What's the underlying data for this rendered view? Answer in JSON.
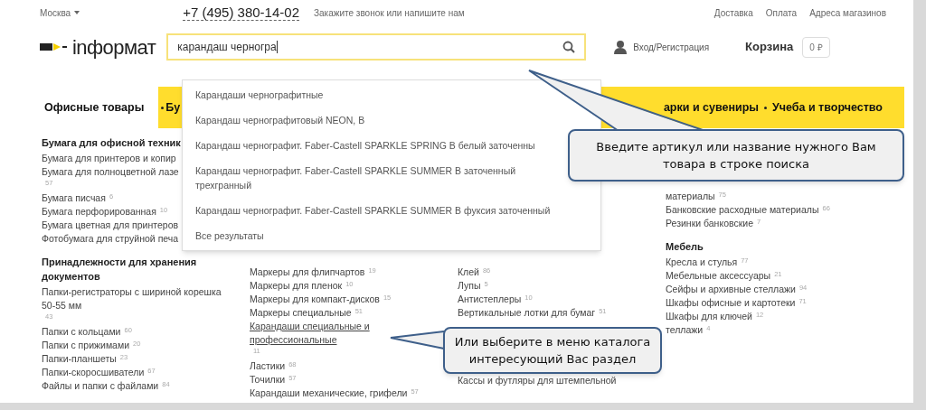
{
  "topbar": {
    "city": "Москва",
    "phone": "+7 (495) 380-14-02",
    "callback": "Закажите звонок или напишите нам",
    "links": [
      "Доставка",
      "Оплата",
      "Адреса магазинов"
    ]
  },
  "header": {
    "logo": "inформат",
    "search_value": "карандаш черногра",
    "login": "Вход/Регистрация",
    "cart": "Корзина",
    "cart_total": "0 ₽"
  },
  "suggestions": {
    "items": [
      "Карандаши чернографитные",
      "Карандаш чернографитовый NEON, B",
      "Карандаш чернографит. Faber-Castell SPARKLE SPRING B белый заточенны",
      "Карандаш чернографит. Faber-Castell SPARKLE SUMMER B заточенный трехгранный",
      "Карандаш чернографит. Faber-Castell SPARKLE SUMMER B фуксия заточенный"
    ],
    "all_results": "Все результаты"
  },
  "nav": [
    {
      "label": "Офисные товары",
      "selected": true
    },
    {
      "label": "Бу",
      "selected": false
    },
    {
      "label": "арки и сувениры",
      "selected": false
    },
    {
      "label": "Учеба и творчество",
      "selected": false
    }
  ],
  "columns": [
    [
      {
        "kind": "heading",
        "label": "Бумага для офисной техник"
      },
      {
        "kind": "link",
        "label": "Бумага для принтеров и копир",
        "hovered": false
      },
      {
        "kind": "link",
        "label": "Бумага для полноцветной лазе",
        "count": "57",
        "hovered": false
      },
      {
        "kind": "link",
        "label": "Бумага писчая",
        "count": "6",
        "hovered": false
      },
      {
        "kind": "link",
        "label": "Бумага перфорированная",
        "count": "10",
        "hovered": false
      },
      {
        "kind": "link",
        "label": "Бумага цветная для принтеров",
        "hovered": false
      },
      {
        "kind": "link",
        "label": "Фотобумага для струйной печа",
        "hovered": false
      },
      {
        "kind": "heading",
        "label": "Принадлежности для хранения документов"
      },
      {
        "kind": "link",
        "label": "Папки-регистраторы с шириной корешка 50-55 мм",
        "count": "43",
        "hovered": false
      },
      {
        "kind": "link",
        "label": "Папки с кольцами",
        "count": "60",
        "hovered": false
      },
      {
        "kind": "link",
        "label": "Папки с прижимами",
        "count": "20",
        "hovered": false
      },
      {
        "kind": "link",
        "label": "Папки-планшеты",
        "count": "23",
        "hovered": false
      },
      {
        "kind": "link",
        "label": "Папки-скоросшиватели",
        "count": "67",
        "hovered": false
      },
      {
        "kind": "link",
        "label": "Файлы и папки с файлами",
        "count": "84",
        "hovered": false
      }
    ],
    [
      {
        "kind": "link",
        "label": "Маркеры для флипчартов",
        "count": "19",
        "hovered": false
      },
      {
        "kind": "link",
        "label": "Маркеры для пленок",
        "count": "10",
        "hovered": false
      },
      {
        "kind": "link",
        "label": "Маркеры для компакт-дисков",
        "count": "15",
        "hovered": false
      },
      {
        "kind": "link",
        "label": "Маркеры специальные",
        "count": "51",
        "hovered": false
      },
      {
        "kind": "link",
        "label": "Карандаши специальные и профессиональные",
        "count": "11",
        "hovered": true
      },
      {
        "kind": "link",
        "label": "Ластики",
        "count": "68",
        "hovered": false
      },
      {
        "kind": "link",
        "label": "Точилки",
        "count": "57",
        "hovered": false
      },
      {
        "kind": "link",
        "label": "Карандаши механические, грифели",
        "count": "57",
        "hovered": false
      }
    ],
    [
      {
        "kind": "link",
        "label": "Клей",
        "count": "86",
        "hovered": false
      },
      {
        "kind": "link",
        "label": "Лупы",
        "count": "5",
        "hovered": false
      },
      {
        "kind": "link",
        "label": "Антистеплеры",
        "count": "10",
        "hovered": false
      },
      {
        "kind": "link",
        "label": "Вертикальные лотки для бумаг",
        "count": "51",
        "hovered": false
      },
      {
        "kind": "spacer"
      },
      {
        "kind": "link",
        "label": "Кассы и футляры для штемпельной",
        "hovered": false
      }
    ],
    [
      {
        "kind": "link",
        "label": "материалы",
        "count": "75",
        "hovered": false
      },
      {
        "kind": "link",
        "label": "Банковские расходные материалы",
        "count": "66",
        "hovered": false
      },
      {
        "kind": "link",
        "label": "Резинки банковские",
        "count": "7",
        "hovered": false
      },
      {
        "kind": "heading",
        "label": "Мебель"
      },
      {
        "kind": "link",
        "label": "Кресла и стулья",
        "count": "77",
        "hovered": false
      },
      {
        "kind": "link",
        "label": "Мебельные аксессуары",
        "count": "21",
        "hovered": false
      },
      {
        "kind": "link",
        "label": "Сейфы и архивные стеллажи",
        "count": "94",
        "hovered": false
      },
      {
        "kind": "link",
        "label": "Шкафы офисные и картотеки",
        "count": "71",
        "hovered": false
      },
      {
        "kind": "link",
        "label": "Шкафы для ключей",
        "count": "12",
        "hovered": false
      },
      {
        "kind": "link",
        "label": "теллажи",
        "count": "4",
        "hovered": false
      }
    ]
  ],
  "callouts": [
    "Введите артикул или название нужного Вам товара в строке поиска",
    "Или выберите в меню каталога интересующий Вас раздел"
  ]
}
